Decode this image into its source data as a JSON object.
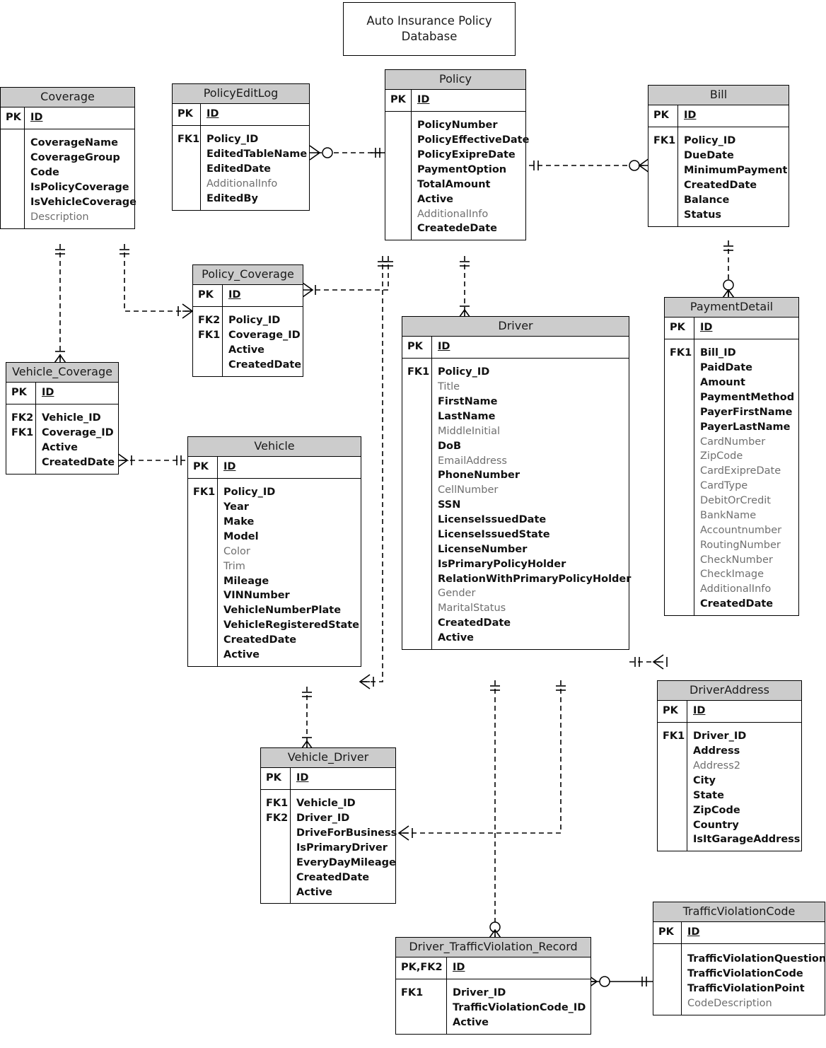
{
  "diagram": {
    "title": "Auto Insurance Policy\nDatabase",
    "title_line1": "Auto Insurance Policy",
    "title_line2": "Database",
    "notation": "crows-foot",
    "header_fill": "#cccccc",
    "line_color": "#000000",
    "required_color": "#111111",
    "optional_color": "#6f6f6f"
  },
  "entities": {
    "coverage": {
      "name": "Coverage",
      "key_label": "PK",
      "pk": "ID",
      "fk_label": "",
      "fields": [
        {
          "name": "CoverageName",
          "required": true
        },
        {
          "name": "CoverageGroup",
          "required": true
        },
        {
          "name": "Code",
          "required": true
        },
        {
          "name": "IsPolicyCoverage",
          "required": true
        },
        {
          "name": "IsVehicleCoverage",
          "required": true
        },
        {
          "name": "Description",
          "required": false
        }
      ]
    },
    "policyeditlog": {
      "name": "PolicyEditLog",
      "key_label": "PK",
      "pk": "ID",
      "fk_label": "FK1",
      "fields": [
        {
          "name": "Policy_ID",
          "required": true
        },
        {
          "name": "EditedTableName",
          "required": true
        },
        {
          "name": "EditedDate",
          "required": true
        },
        {
          "name": "AdditionalInfo",
          "required": false
        },
        {
          "name": "EditedBy",
          "required": true
        }
      ]
    },
    "policy": {
      "name": "Policy",
      "key_label": "PK",
      "pk": "ID",
      "fk_label": "",
      "fields": [
        {
          "name": "PolicyNumber",
          "required": true
        },
        {
          "name": "PolicyEffectiveDate",
          "required": true
        },
        {
          "name": "PolicyExipreDate",
          "required": true
        },
        {
          "name": "PaymentOption",
          "required": true
        },
        {
          "name": "TotalAmount",
          "required": true
        },
        {
          "name": "Active",
          "required": true
        },
        {
          "name": "AdditionalInfo",
          "required": false
        },
        {
          "name": "CreatedeDate",
          "required": true
        }
      ]
    },
    "bill": {
      "name": "Bill",
      "key_label": "PK",
      "pk": "ID",
      "fk_label": "FK1",
      "fields": [
        {
          "name": "Policy_ID",
          "required": true
        },
        {
          "name": "DueDate",
          "required": true
        },
        {
          "name": "MinimumPayment",
          "required": true
        },
        {
          "name": "CreatedDate",
          "required": true
        },
        {
          "name": "Balance",
          "required": true
        },
        {
          "name": "Status",
          "required": true
        }
      ]
    },
    "policy_coverage": {
      "name": "Policy_Coverage",
      "key_label": "PK",
      "pk": "ID",
      "fk_label": "FK2\nFK1",
      "fk_label_lines": [
        "FK2",
        "FK1"
      ],
      "fields": [
        {
          "name": "Policy_ID",
          "required": true
        },
        {
          "name": "Coverage_ID",
          "required": true
        },
        {
          "name": "Active",
          "required": true
        },
        {
          "name": "CreatedDate",
          "required": true
        }
      ]
    },
    "vehicle_coverage": {
      "name": "Vehicle_Coverage",
      "key_label": "PK",
      "pk": "ID",
      "fk_label_lines": [
        "FK2",
        "FK1"
      ],
      "fields": [
        {
          "name": "Vehicle_ID",
          "required": true
        },
        {
          "name": "Coverage_ID",
          "required": true
        },
        {
          "name": "Active",
          "required": true
        },
        {
          "name": "CreatedDate",
          "required": true
        }
      ]
    },
    "vehicle": {
      "name": "Vehicle",
      "key_label": "PK",
      "pk": "ID",
      "fk_label": "FK1",
      "fields": [
        {
          "name": "Policy_ID",
          "required": true
        },
        {
          "name": "Year",
          "required": true
        },
        {
          "name": "Make",
          "required": true
        },
        {
          "name": "Model",
          "required": true
        },
        {
          "name": "Color",
          "required": false
        },
        {
          "name": "Trim",
          "required": false
        },
        {
          "name": "Mileage",
          "required": true
        },
        {
          "name": "VINNumber",
          "required": true
        },
        {
          "name": "VehicleNumberPlate",
          "required": true
        },
        {
          "name": "VehicleRegisteredState",
          "required": true
        },
        {
          "name": "CreatedDate",
          "required": true
        },
        {
          "name": "Active",
          "required": true
        }
      ]
    },
    "driver": {
      "name": "Driver",
      "key_label": "PK",
      "pk": "ID",
      "fk_label": "FK1",
      "fields": [
        {
          "name": "Policy_ID",
          "required": true
        },
        {
          "name": "Title",
          "required": false
        },
        {
          "name": "FirstName",
          "required": true
        },
        {
          "name": "LastName",
          "required": true
        },
        {
          "name": "MiddleInitial",
          "required": false
        },
        {
          "name": "DoB",
          "required": true
        },
        {
          "name": "EmailAddress",
          "required": false
        },
        {
          "name": "PhoneNumber",
          "required": true
        },
        {
          "name": "CellNumber",
          "required": false
        },
        {
          "name": "SSN",
          "required": true
        },
        {
          "name": "LicenseIssuedDate",
          "required": true
        },
        {
          "name": "LicenseIssuedState",
          "required": true
        },
        {
          "name": "LicenseNumber",
          "required": true
        },
        {
          "name": "IsPrimaryPolicyHolder",
          "required": true
        },
        {
          "name": "RelationWithPrimaryPolicyHolder",
          "required": true
        },
        {
          "name": "Gender",
          "required": false
        },
        {
          "name": "MaritalStatus",
          "required": false
        },
        {
          "name": "CreatedDate",
          "required": true
        },
        {
          "name": "Active",
          "required": true
        }
      ]
    },
    "paymentdetail": {
      "name": "PaymentDetail",
      "key_label": "PK",
      "pk": "ID",
      "fk_label": "FK1",
      "fields": [
        {
          "name": "Bill_ID",
          "required": true
        },
        {
          "name": "PaidDate",
          "required": true
        },
        {
          "name": "Amount",
          "required": true
        },
        {
          "name": "PaymentMethod",
          "required": true
        },
        {
          "name": "PayerFirstName",
          "required": true
        },
        {
          "name": "PayerLastName",
          "required": true
        },
        {
          "name": "CardNumber",
          "required": false
        },
        {
          "name": "ZipCode",
          "required": false
        },
        {
          "name": "CardExipreDate",
          "required": false
        },
        {
          "name": "CardType",
          "required": false
        },
        {
          "name": "DebitOrCredit",
          "required": false
        },
        {
          "name": "BankName",
          "required": false
        },
        {
          "name": "Accountnumber",
          "required": false
        },
        {
          "name": "RoutingNumber",
          "required": false
        },
        {
          "name": "CheckNumber",
          "required": false
        },
        {
          "name": "CheckImage",
          "required": false
        },
        {
          "name": "AdditionalInfo",
          "required": false
        },
        {
          "name": "CreatedDate",
          "required": true
        }
      ]
    },
    "driveraddress": {
      "name": "DriverAddress",
      "key_label": "PK",
      "pk": "ID",
      "fk_label": "FK1",
      "fields": [
        {
          "name": "Driver_ID",
          "required": true
        },
        {
          "name": "Address",
          "required": true
        },
        {
          "name": "Address2",
          "required": false
        },
        {
          "name": "City",
          "required": true
        },
        {
          "name": "State",
          "required": true
        },
        {
          "name": "ZipCode",
          "required": true
        },
        {
          "name": "Country",
          "required": true
        },
        {
          "name": "IsItGarageAddress",
          "required": true
        }
      ]
    },
    "vehicle_driver": {
      "name": "Vehicle_Driver",
      "key_label": "PK",
      "pk": "ID",
      "fk_label_lines": [
        "FK1",
        "FK2"
      ],
      "fields": [
        {
          "name": "Vehicle_ID",
          "required": true
        },
        {
          "name": "Driver_ID",
          "required": true
        },
        {
          "name": "DriveForBusiness",
          "required": true
        },
        {
          "name": "IsPrimaryDriver",
          "required": true
        },
        {
          "name": "EveryDayMileage",
          "required": true
        },
        {
          "name": "CreatedDate",
          "required": true
        },
        {
          "name": "Active",
          "required": true
        }
      ]
    },
    "driver_trafficviolation_record": {
      "name": "Driver_TrafficViolation_Record",
      "key_label": "PK,FK2",
      "pk": "ID",
      "fk_label": "FK1",
      "fields": [
        {
          "name": "Driver_ID",
          "required": true
        },
        {
          "name": "TrafficViolationCode_ID",
          "required": true
        },
        {
          "name": "Active",
          "required": true
        }
      ]
    },
    "trafficviolationcode": {
      "name": "TrafficViolationCode",
      "key_label": "PK",
      "pk": "ID",
      "fk_label": "",
      "fields": [
        {
          "name": "TrafficViolationQuestion",
          "required": true
        },
        {
          "name": "TrafficViolationCode",
          "required": true
        },
        {
          "name": "TrafficViolationPoint",
          "required": true
        },
        {
          "name": "CodeDescription",
          "required": false
        }
      ]
    }
  },
  "relationships": [
    {
      "from": "PolicyEditLog",
      "to": "Policy",
      "from_cardinality": "zero-or-many",
      "to_cardinality": "exactly-one",
      "style": "dashed"
    },
    {
      "from": "Policy",
      "to": "Bill",
      "from_cardinality": "exactly-one",
      "to_cardinality": "zero-or-many",
      "style": "dashed"
    },
    {
      "from": "Bill",
      "to": "PaymentDetail",
      "from_cardinality": "exactly-one",
      "to_cardinality": "zero-or-many",
      "style": "dashed"
    },
    {
      "from": "Policy",
      "to": "Policy_Coverage",
      "from_cardinality": "exactly-one",
      "to_cardinality": "one-or-many",
      "style": "dashed"
    },
    {
      "from": "Coverage",
      "to": "Policy_Coverage",
      "from_cardinality": "exactly-one",
      "to_cardinality": "one-or-many",
      "style": "dashed"
    },
    {
      "from": "Coverage",
      "to": "Vehicle_Coverage",
      "from_cardinality": "exactly-one",
      "to_cardinality": "one-or-many",
      "style": "dashed"
    },
    {
      "from": "Vehicle_Coverage",
      "to": "Vehicle",
      "from_cardinality": "one-or-many",
      "to_cardinality": "exactly-one",
      "style": "dashed"
    },
    {
      "from": "Policy",
      "to": "Vehicle",
      "from_cardinality": "exactly-one",
      "to_cardinality": "one-or-many",
      "style": "dashed"
    },
    {
      "from": "Policy",
      "to": "Driver",
      "from_cardinality": "exactly-one",
      "to_cardinality": "one-or-many",
      "style": "dashed"
    },
    {
      "from": "Vehicle",
      "to": "Vehicle_Driver",
      "from_cardinality": "exactly-one",
      "to_cardinality": "one-or-many",
      "style": "dashed"
    },
    {
      "from": "Driver",
      "to": "Vehicle_Driver",
      "from_cardinality": "exactly-one",
      "to_cardinality": "one-or-many",
      "style": "dashed"
    },
    {
      "from": "Driver",
      "to": "DriverAddress",
      "from_cardinality": "exactly-one",
      "to_cardinality": "one-or-many",
      "style": "dashed"
    },
    {
      "from": "Driver",
      "to": "Driver_TrafficViolation_Record",
      "from_cardinality": "exactly-one",
      "to_cardinality": "zero-or-many",
      "style": "dashed"
    },
    {
      "from": "Driver_TrafficViolation_Record",
      "to": "TrafficViolationCode",
      "from_cardinality": "zero-or-many",
      "to_cardinality": "exactly-one",
      "style": "solid"
    }
  ]
}
